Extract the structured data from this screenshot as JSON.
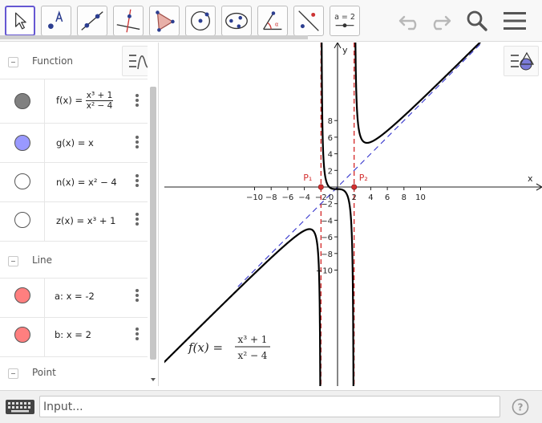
{
  "toolbar": {
    "slider_label": "a = 2"
  },
  "algebra": {
    "groups": {
      "function": "Function",
      "line": "Line",
      "point": "Point"
    },
    "items": [
      {
        "name": "f",
        "lhs": "f(x)  =",
        "num": "x³ + 1",
        "den": "x² − 4",
        "color": "#808080",
        "filled": true
      },
      {
        "name": "g",
        "text": "g(x)  =  x",
        "color": "#9999ff",
        "filled": true
      },
      {
        "name": "n",
        "text": "n(x)  =  x² − 4",
        "color": "#ffffff",
        "filled": false
      },
      {
        "name": "z",
        "text": "z(x)  =  x³ + 1",
        "color": "#ffffff",
        "filled": false
      },
      {
        "name": "a",
        "text": "a:  x  =  -2",
        "color": "#ff7f7f",
        "filled": true
      },
      {
        "name": "b",
        "text": "b:  x  =  2",
        "color": "#ff7f7f",
        "filled": true
      }
    ]
  },
  "graphics": {
    "x_axis_label": "x",
    "y_axis_label": "y",
    "x_ticks": [
      "−10",
      "−8",
      "−6",
      "−4",
      "−2",
      "0",
      "2",
      "4",
      "6",
      "8",
      "10"
    ],
    "y_ticks": [
      "8",
      "6",
      "4",
      "2",
      "−2",
      "−4",
      "−6",
      "−8",
      "−10"
    ],
    "point_labels": [
      "P₁",
      "P₂"
    ],
    "text_lhs": "f(x)  =",
    "text_num": "x³ + 1",
    "text_den": "x² − 4",
    "colors": {
      "function": "#000000",
      "asymptote": "#cc0000",
      "oblique": "#3333cc",
      "point": "#d32f2f"
    }
  },
  "inputbar": {
    "placeholder": "Input..."
  },
  "chart_data": {
    "type": "line",
    "title": "",
    "xlabel": "x",
    "ylabel": "y",
    "xlim": [
      -10.5,
      12.1
    ],
    "ylim": [
      -12,
      8.5
    ],
    "grid": false,
    "series": [
      {
        "name": "f",
        "kind": "function",
        "expr": "(x^3+1)/(x^2-4)"
      },
      {
        "name": "g",
        "kind": "function",
        "expr": "x"
      },
      {
        "name": "a",
        "kind": "vertical",
        "x": -2
      },
      {
        "name": "b",
        "kind": "vertical",
        "x": 2
      }
    ],
    "points": [
      {
        "label": "P₁",
        "x": -2,
        "y": 0
      },
      {
        "label": "P₂",
        "x": 2,
        "y": 0
      }
    ]
  }
}
